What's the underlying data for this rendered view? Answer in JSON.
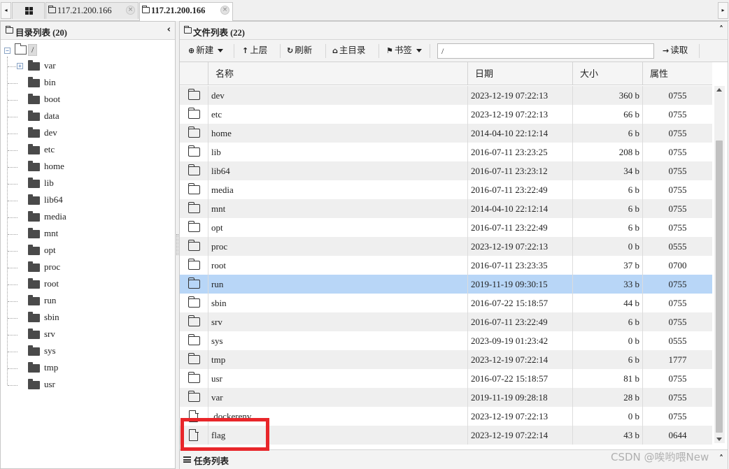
{
  "tabs": {
    "scroll_left": "◂",
    "scroll_right": "▸",
    "home_icon": "grid-icon",
    "items": [
      {
        "label": "117.21.200.166",
        "close": "×"
      },
      {
        "label": "117.21.200.166",
        "close": "×"
      }
    ]
  },
  "left_panel": {
    "title": "目录列表 (20)",
    "collapse": "‹",
    "root_toggle": "−",
    "root_label": "/",
    "items": [
      {
        "label": "var",
        "toggle": "+"
      },
      {
        "label": "bin"
      },
      {
        "label": "boot"
      },
      {
        "label": "data"
      },
      {
        "label": "dev"
      },
      {
        "label": "etc"
      },
      {
        "label": "home"
      },
      {
        "label": "lib"
      },
      {
        "label": "lib64"
      },
      {
        "label": "media"
      },
      {
        "label": "mnt"
      },
      {
        "label": "opt"
      },
      {
        "label": "proc"
      },
      {
        "label": "root"
      },
      {
        "label": "run"
      },
      {
        "label": "sbin"
      },
      {
        "label": "srv"
      },
      {
        "label": "sys"
      },
      {
        "label": "tmp"
      },
      {
        "label": "usr"
      }
    ]
  },
  "right_panel": {
    "title": "文件列表 (22)",
    "collapse": "˄",
    "toolbar": {
      "new": {
        "icon": "⊕",
        "label": "新建"
      },
      "up": {
        "icon": "↑",
        "label": "上层"
      },
      "refresh": {
        "icon": "↻",
        "label": "刷新"
      },
      "home": {
        "icon": "⌂",
        "label": "主目录"
      },
      "bookmark": {
        "icon": "⚑",
        "label": "书签"
      },
      "path_value": "/",
      "read": {
        "icon": "→",
        "label": "读取"
      }
    },
    "columns": {
      "name": "名称",
      "date": "日期",
      "size": "大小",
      "perm": "属性"
    },
    "rows": [
      {
        "type": "folder",
        "name": "dev",
        "date": "2023-12-19 07:22:13",
        "size": "360 b",
        "perm": "0755"
      },
      {
        "type": "folder",
        "name": "etc",
        "date": "2023-12-19 07:22:13",
        "size": "66 b",
        "perm": "0755"
      },
      {
        "type": "folder",
        "name": "home",
        "date": "2014-04-10 22:12:14",
        "size": "6 b",
        "perm": "0755"
      },
      {
        "type": "folder",
        "name": "lib",
        "date": "2016-07-11 23:23:25",
        "size": "208 b",
        "perm": "0755"
      },
      {
        "type": "folder",
        "name": "lib64",
        "date": "2016-07-11 23:23:12",
        "size": "34 b",
        "perm": "0755"
      },
      {
        "type": "folder",
        "name": "media",
        "date": "2016-07-11 23:22:49",
        "size": "6 b",
        "perm": "0755"
      },
      {
        "type": "folder",
        "name": "mnt",
        "date": "2014-04-10 22:12:14",
        "size": "6 b",
        "perm": "0755"
      },
      {
        "type": "folder",
        "name": "opt",
        "date": "2016-07-11 23:22:49",
        "size": "6 b",
        "perm": "0755"
      },
      {
        "type": "folder",
        "name": "proc",
        "date": "2023-12-19 07:22:13",
        "size": "0 b",
        "perm": "0555"
      },
      {
        "type": "folder",
        "name": "root",
        "date": "2016-07-11 23:23:35",
        "size": "37 b",
        "perm": "0700"
      },
      {
        "type": "folder",
        "name": "run",
        "date": "2019-11-19 09:30:15",
        "size": "33 b",
        "perm": "0755",
        "selected": true
      },
      {
        "type": "folder",
        "name": "sbin",
        "date": "2016-07-22 15:18:57",
        "size": "44 b",
        "perm": "0755"
      },
      {
        "type": "folder",
        "name": "srv",
        "date": "2016-07-11 23:22:49",
        "size": "6 b",
        "perm": "0755"
      },
      {
        "type": "folder",
        "name": "sys",
        "date": "2023-09-19 01:23:42",
        "size": "0 b",
        "perm": "0555"
      },
      {
        "type": "folder",
        "name": "tmp",
        "date": "2023-12-19 07:22:14",
        "size": "6 b",
        "perm": "1777"
      },
      {
        "type": "folder",
        "name": "usr",
        "date": "2016-07-22 15:18:57",
        "size": "81 b",
        "perm": "0755"
      },
      {
        "type": "folder",
        "name": "var",
        "date": "2019-11-19 09:28:18",
        "size": "28 b",
        "perm": "0755"
      },
      {
        "type": "file",
        "name": ".dockerenv",
        "date": "2023-12-19 07:22:13",
        "size": "0 b",
        "perm": "0755"
      },
      {
        "type": "file",
        "name": "flag",
        "date": "2023-12-19 07:22:14",
        "size": "43 b",
        "perm": "0644"
      }
    ]
  },
  "task_panel": {
    "title": "任务列表",
    "collapse": "˄"
  },
  "watermark": "CSDN @唉哟喂New",
  "colors": {
    "selected_row": "#b8d6f7",
    "highlight_box": "#e8262a",
    "odd_row": "#efefef"
  }
}
